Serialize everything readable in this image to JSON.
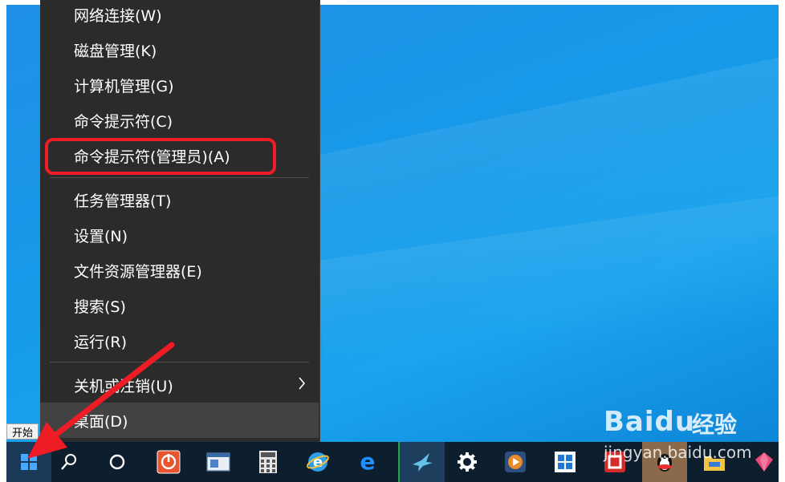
{
  "context_menu": {
    "items": [
      {
        "label": "网络连接(W)"
      },
      {
        "label": "磁盘管理(K)"
      },
      {
        "label": "计算机管理(G)"
      },
      {
        "label": "命令提示符(C)"
      },
      {
        "label": "命令提示符(管理员)(A)"
      },
      {
        "label": "任务管理器(T)"
      },
      {
        "label": "设置(N)"
      },
      {
        "label": "文件资源管理器(E)"
      },
      {
        "label": "搜索(S)"
      },
      {
        "label": "运行(R)"
      },
      {
        "label": "关机或注销(U)"
      },
      {
        "label": "桌面(D)"
      }
    ]
  },
  "start_tooltip": "开始",
  "watermark": {
    "brand": "Baidu",
    "cn": "经验",
    "url": "jingyan.baidu.com"
  },
  "colors": {
    "highlight": "#ee1c25",
    "arrow": "#ee1c25",
    "menu_bg": "#2b2b2b",
    "taskbar_bg": "#0d1f2f"
  }
}
